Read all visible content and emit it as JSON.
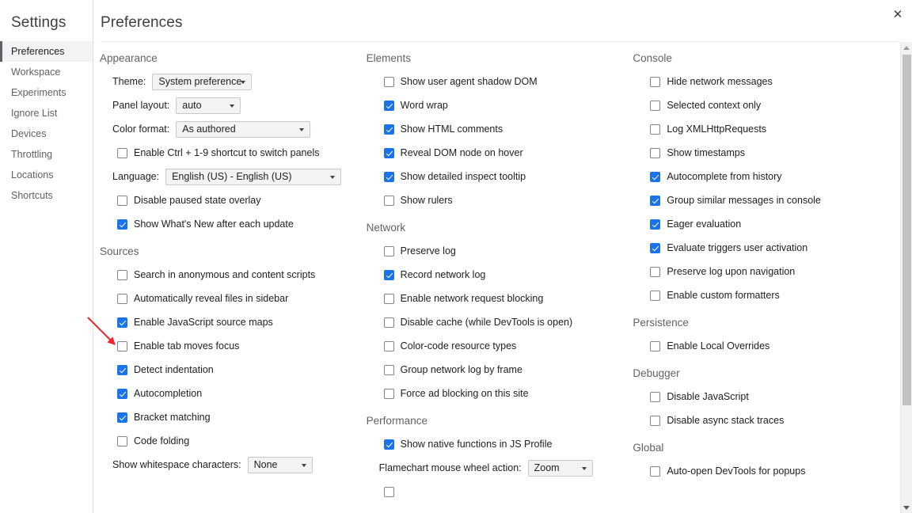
{
  "window": {
    "close_label": "✕"
  },
  "sidebar": {
    "title": "Settings",
    "items": [
      {
        "label": "Preferences",
        "selected": true
      },
      {
        "label": "Workspace",
        "selected": false
      },
      {
        "label": "Experiments",
        "selected": false
      },
      {
        "label": "Ignore List",
        "selected": false
      },
      {
        "label": "Devices",
        "selected": false
      },
      {
        "label": "Throttling",
        "selected": false
      },
      {
        "label": "Locations",
        "selected": false
      },
      {
        "label": "Shortcuts",
        "selected": false
      }
    ]
  },
  "header": {
    "title": "Preferences"
  },
  "colors": {
    "accent_checkbox": "#1a73e8",
    "section_heading": "#5f6368",
    "selected_item_bg": "#f1f3f4",
    "selected_item_bar": "#5f6368",
    "annotation_arrow": "#e8272c",
    "scrollbar_thumb": "#c1c1c1"
  },
  "columns": [
    {
      "name": "left",
      "sections": [
        {
          "title": "Appearance",
          "rows": [
            {
              "type": "select",
              "label": "Theme:",
              "value": "System preference",
              "width": "w-theme"
            },
            {
              "type": "select",
              "label": "Panel layout:",
              "value": "auto",
              "width": "w-panel"
            },
            {
              "type": "select",
              "label": "Color format:",
              "value": "As authored",
              "width": "w-color"
            },
            {
              "type": "checkbox",
              "label": "Enable Ctrl + 1-9 shortcut to switch panels",
              "checked": false
            },
            {
              "type": "select",
              "label": "Language:",
              "value": "English (US) - English (US)",
              "width": "w-lang"
            },
            {
              "type": "checkbox",
              "label": "Disable paused state overlay",
              "checked": false
            },
            {
              "type": "checkbox",
              "label": "Show What's New after each update",
              "checked": true
            }
          ]
        },
        {
          "title": "Sources",
          "rows": [
            {
              "type": "checkbox",
              "label": "Search in anonymous and content scripts",
              "checked": false
            },
            {
              "type": "checkbox",
              "label": "Automatically reveal files in sidebar",
              "checked": false
            },
            {
              "type": "checkbox",
              "label": "Enable JavaScript source maps",
              "checked": true,
              "annotated": true
            },
            {
              "type": "checkbox",
              "label": "Enable tab moves focus",
              "checked": false
            },
            {
              "type": "checkbox",
              "label": "Detect indentation",
              "checked": true
            },
            {
              "type": "checkbox",
              "label": "Autocompletion",
              "checked": true
            },
            {
              "type": "checkbox",
              "label": "Bracket matching",
              "checked": true
            },
            {
              "type": "checkbox",
              "label": "Code folding",
              "checked": false
            },
            {
              "type": "select",
              "label": "Show whitespace characters:",
              "value": "None",
              "width": "w-ws"
            }
          ]
        }
      ]
    },
    {
      "name": "middle",
      "sections": [
        {
          "title": "Elements",
          "rows": [
            {
              "type": "checkbox",
              "label": "Show user agent shadow DOM",
              "checked": false
            },
            {
              "type": "checkbox",
              "label": "Word wrap",
              "checked": true
            },
            {
              "type": "checkbox",
              "label": "Show HTML comments",
              "checked": true
            },
            {
              "type": "checkbox",
              "label": "Reveal DOM node on hover",
              "checked": true
            },
            {
              "type": "checkbox",
              "label": "Show detailed inspect tooltip",
              "checked": true
            },
            {
              "type": "checkbox",
              "label": "Show rulers",
              "checked": false
            }
          ]
        },
        {
          "title": "Network",
          "rows": [
            {
              "type": "checkbox",
              "label": "Preserve log",
              "checked": false
            },
            {
              "type": "checkbox",
              "label": "Record network log",
              "checked": true
            },
            {
              "type": "checkbox",
              "label": "Enable network request blocking",
              "checked": false
            },
            {
              "type": "checkbox",
              "label": "Disable cache (while DevTools is open)",
              "checked": false
            },
            {
              "type": "checkbox",
              "label": "Color-code resource types",
              "checked": false
            },
            {
              "type": "checkbox",
              "label": "Group network log by frame",
              "checked": false
            },
            {
              "type": "checkbox",
              "label": "Force ad blocking on this site",
              "checked": false
            }
          ]
        },
        {
          "title": "Performance",
          "rows": [
            {
              "type": "checkbox",
              "label": "Show native functions in JS Profile",
              "checked": true
            },
            {
              "type": "select",
              "label": "Flamechart mouse wheel action:",
              "value": "Zoom",
              "width": "w-flame"
            },
            {
              "type": "checkbox",
              "label": "",
              "checked": false,
              "clipped": true
            }
          ]
        }
      ]
    },
    {
      "name": "right",
      "sections": [
        {
          "title": "Console",
          "rows": [
            {
              "type": "checkbox",
              "label": "Hide network messages",
              "checked": false
            },
            {
              "type": "checkbox",
              "label": "Selected context only",
              "checked": false
            },
            {
              "type": "checkbox",
              "label": "Log XMLHttpRequests",
              "checked": false
            },
            {
              "type": "checkbox",
              "label": "Show timestamps",
              "checked": false
            },
            {
              "type": "checkbox",
              "label": "Autocomplete from history",
              "checked": true
            },
            {
              "type": "checkbox",
              "label": "Group similar messages in console",
              "checked": true
            },
            {
              "type": "checkbox",
              "label": "Eager evaluation",
              "checked": true
            },
            {
              "type": "checkbox",
              "label": "Evaluate triggers user activation",
              "checked": true
            },
            {
              "type": "checkbox",
              "label": "Preserve log upon navigation",
              "checked": false
            },
            {
              "type": "checkbox",
              "label": "Enable custom formatters",
              "checked": false
            }
          ]
        },
        {
          "title": "Persistence",
          "rows": [
            {
              "type": "checkbox",
              "label": "Enable Local Overrides",
              "checked": false
            }
          ]
        },
        {
          "title": "Debugger",
          "rows": [
            {
              "type": "checkbox",
              "label": "Disable JavaScript",
              "checked": false
            },
            {
              "type": "checkbox",
              "label": "Disable async stack traces",
              "checked": false
            }
          ]
        },
        {
          "title": "Global",
          "rows": [
            {
              "type": "checkbox",
              "label": "Auto-open DevTools for popups",
              "checked": false
            }
          ]
        }
      ]
    }
  ]
}
